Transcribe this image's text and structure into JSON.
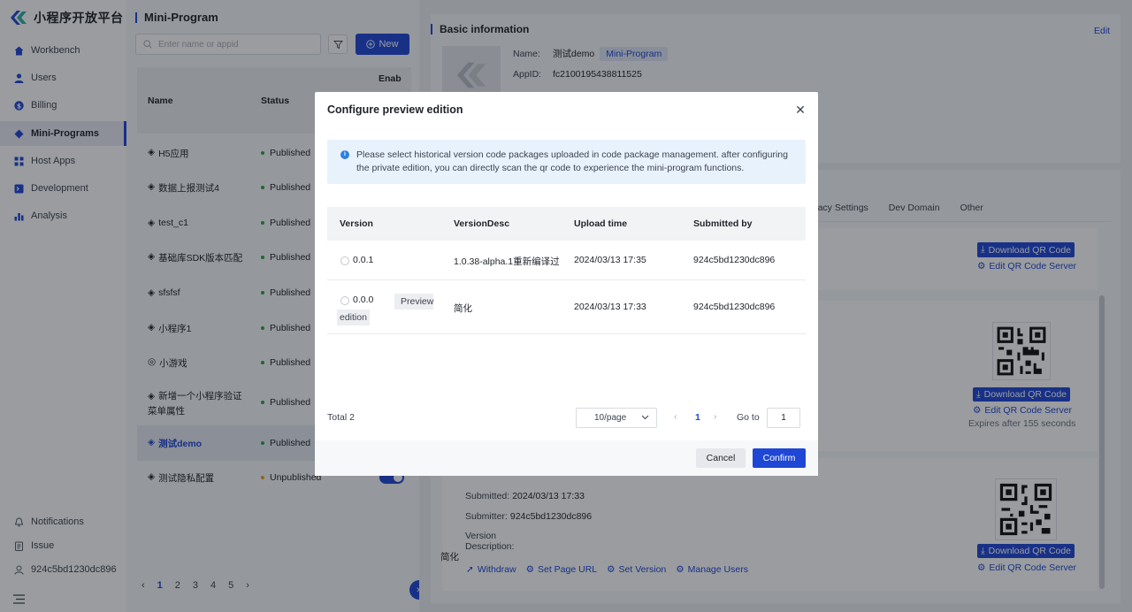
{
  "app": {
    "name": "小程序开放平台"
  },
  "sidebar": {
    "items": [
      {
        "label": "Workbench",
        "icon": "home-icon"
      },
      {
        "label": "Users",
        "icon": "user-icon"
      },
      {
        "label": "Billing",
        "icon": "billing-icon"
      },
      {
        "label": "Mini-Programs",
        "icon": "mini-program-icon",
        "active": true
      },
      {
        "label": "Host Apps",
        "icon": "grid-icon"
      },
      {
        "label": "Development",
        "icon": "terminal-icon"
      },
      {
        "label": "Analysis",
        "icon": "chart-icon"
      }
    ],
    "bottom": [
      {
        "label": "Notifications",
        "icon": "bell-icon"
      },
      {
        "label": "Issue",
        "icon": "clipboard-icon"
      },
      {
        "label": "924c5bd1230dc896",
        "icon": "account-icon"
      }
    ]
  },
  "list": {
    "title": "Mini-Program",
    "search_placeholder": "Enter name or appid",
    "new_label": "New",
    "columns": {
      "name": "Name",
      "status": "Status",
      "enable": "Enab"
    },
    "rows": [
      {
        "name": "H5应用",
        "status": "Published"
      },
      {
        "name": "数据上报测试4",
        "status": "Published"
      },
      {
        "name": "test_c1",
        "status": "Published"
      },
      {
        "name": "基础库SDK版本匹配",
        "status": "Published"
      },
      {
        "name": "sfsfsf",
        "status": "Published"
      },
      {
        "name": "小程序1",
        "status": "Published"
      },
      {
        "name": "小游戏",
        "status": "Published"
      },
      {
        "name": "新增一个小程序验证",
        "name2": "菜单属性",
        "status": "Published"
      },
      {
        "name": "测试demo",
        "status": "Published",
        "selected": true
      },
      {
        "name": "测试隐私配置",
        "status": "Unpublished"
      }
    ],
    "pages": [
      "1",
      "2",
      "3",
      "4",
      "5"
    ],
    "current_page": "1"
  },
  "detail": {
    "section_title": "Basic information",
    "edit_label": "Edit",
    "name_label": "Name:",
    "name_value": "测试demo",
    "type_tag": "Mini-Program",
    "appid_label": "AppID:",
    "appid_value": "fc2100195438811525",
    "tabs": [
      "ivacy Settings",
      "Dev Domain",
      "Other"
    ],
    "download_qr": "Download QR Code",
    "edit_qr_server": "Edit QR Code Server",
    "expires": "Expires after 155 seconds",
    "submitted_label": "Submitted:",
    "submitted_value": "2024/03/13 17:33",
    "submitter_label": "Submitter:",
    "submitter_value": "924c5bd1230dc896",
    "version_desc_label": "Version",
    "version_desc_label2": "Description:",
    "version_desc_value": "简化",
    "actions": [
      "Withdraw",
      "Set Page URL",
      "Set Version",
      "Manage Users"
    ]
  },
  "modal": {
    "title": "Configure preview edition",
    "alert": "Please select historical version code packages uploaded in code package management. after configuring the private edition, you can directly scan the qr code to experience the mini-program functions.",
    "columns": [
      "Version",
      "VersionDesc",
      "Upload time",
      "Submitted by"
    ],
    "rows": [
      {
        "version": "0.0.1",
        "desc": "1.0.38-alpha.1重新编译过",
        "upload": "2024/03/13 17:35",
        "by": "924c5bd1230dc896",
        "tag": ""
      },
      {
        "version": "0.0.0",
        "desc": "简化",
        "upload": "2024/03/13 17:33",
        "by": "924c5bd1230dc896",
        "tag": "Preview",
        "tag2": "edition"
      }
    ],
    "total": "Total 2",
    "page_size": "10/page",
    "page": "1",
    "goto_label": "Go to",
    "goto_value": "1",
    "cancel": "Cancel",
    "confirm": "Confirm"
  },
  "colors": {
    "primary": "#1f47d6",
    "published": "#2ea043",
    "unpublished": "#f0a020"
  }
}
